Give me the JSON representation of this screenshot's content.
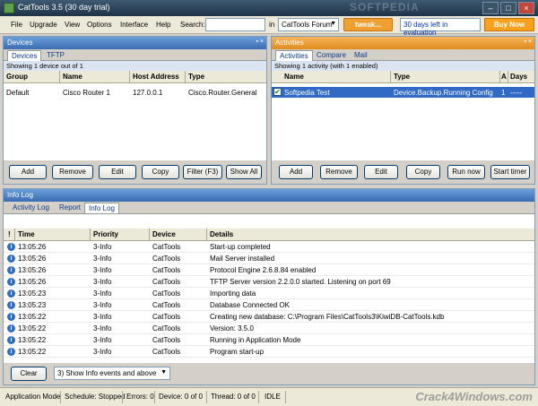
{
  "window": {
    "title": "CatTools 3.5 (30 day trial)",
    "watermark": "SOFTPEDIA"
  },
  "menu": {
    "items": [
      "File",
      "Upgrade",
      "View",
      "Options",
      "Interface",
      "Help"
    ],
    "search_label": "Search:",
    "search_value": "",
    "in_label": "in",
    "search_scope": "CatTools Forum",
    "search_go": "tweak...",
    "eval_text": "30 days left in evaluation",
    "buy_label": "Buy Now"
  },
  "devices": {
    "header": "Devices",
    "tabs": [
      "Devices",
      "TFTP"
    ],
    "info": "Showing 1 device out of 1",
    "columns": [
      "Group",
      "Name",
      "Host Address",
      "Type"
    ],
    "rows": [
      {
        "group": "Default",
        "name": "Cisco Router 1",
        "host": "127.0.0.1",
        "type": "Cisco.Router.General"
      }
    ],
    "buttons": [
      "Add",
      "Remove",
      "Edit",
      "Copy",
      "Filter (F3)",
      "Show All"
    ]
  },
  "activities": {
    "header": "Activities",
    "tabs": [
      "Activities",
      "Compare",
      "Mail"
    ],
    "info": "Showing 1 activity (with 1 enabled)",
    "columns": [
      "Name",
      "Type",
      "A",
      "Days"
    ],
    "rows": [
      {
        "name": "Softpedia Test",
        "type": "Device.Backup.Running Config",
        "a": "1",
        "days": "-----"
      }
    ],
    "buttons": [
      "Add",
      "Remove",
      "Edit",
      "Copy",
      "Run now",
      "Start timer"
    ]
  },
  "log": {
    "header": "Info Log",
    "tabs": [
      "Activity Log",
      "Report",
      "Info Log"
    ],
    "columns": [
      "!",
      "Time",
      "Priority",
      "Device",
      "Details"
    ],
    "rows": [
      {
        "time": "13:05:26",
        "priority": "3-Info",
        "device": "CatTools",
        "details": "Start-up completed"
      },
      {
        "time": "13:05:26",
        "priority": "3-Info",
        "device": "CatTools",
        "details": "Mail Server installed"
      },
      {
        "time": "13:05:26",
        "priority": "3-Info",
        "device": "CatTools",
        "details": "Protocol Engine 2.6.8.84 enabled"
      },
      {
        "time": "13:05:26",
        "priority": "3-Info",
        "device": "CatTools",
        "details": "TFTP Server version 2.2.0.0 started. Listening on port 69"
      },
      {
        "time": "13:05:23",
        "priority": "3-Info",
        "device": "CatTools",
        "details": "Importing data"
      },
      {
        "time": "13:05:23",
        "priority": "3-Info",
        "device": "CatTools",
        "details": "Database Connected OK"
      },
      {
        "time": "13:05:22",
        "priority": "3-Info",
        "device": "CatTools",
        "details": "Creating new database: C:\\Program Files\\CatTools3\\KiwiDB-CatTools.kdb"
      },
      {
        "time": "13:05:22",
        "priority": "3-Info",
        "device": "CatTools",
        "details": "Version: 3.5.0"
      },
      {
        "time": "13:05:22",
        "priority": "3-Info",
        "device": "CatTools",
        "details": "Running in Application Mode"
      },
      {
        "time": "13:05:22",
        "priority": "3-Info",
        "device": "CatTools",
        "details": "Program start-up"
      }
    ],
    "clear_label": "Clear",
    "filter_value": "3) Show Info events and above"
  },
  "status": {
    "mode": "Application Mode",
    "schedule": "Schedule: Stopped",
    "errors": "Errors: 0",
    "device": "Device: 0 of 0",
    "thread": "Thread: 0 of 0",
    "state": "IDLE",
    "watermark": "Crack4Windows.com"
  }
}
